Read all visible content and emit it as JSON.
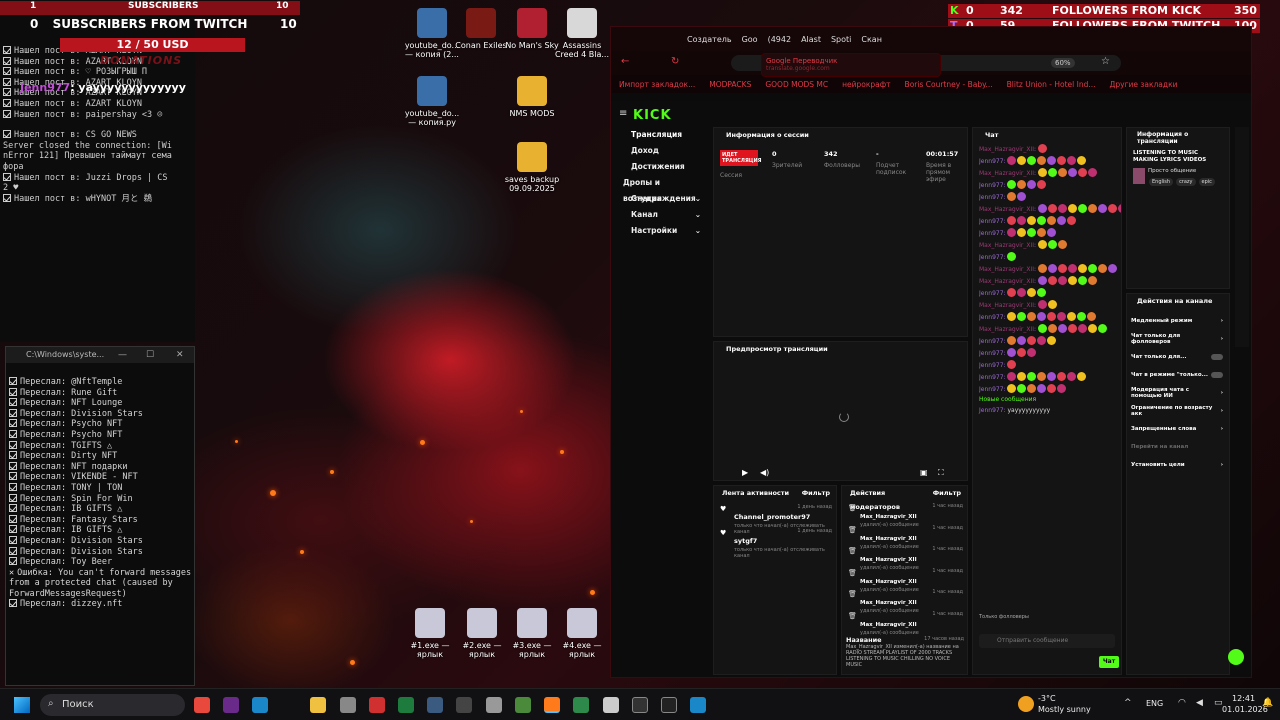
{
  "overlay": {
    "row1_left": "1",
    "row1_label": "SUBSCRIBERS",
    "row1_right": "10",
    "row2_left": "0",
    "subs_label": "SUBSCRIBERS FROM TWITCH",
    "row2_right": "10",
    "money": "12 / 50 USD",
    "donations": "DONATIONS",
    "chat_user": "Jenn977",
    "chat_msg": "yayyyyyyyyyyyyy"
  },
  "console1": {
    "lines": [
      "Нашел пост в: AZART KLOYN",
      "Нашел пост в: AZART KLOYN",
      "Нашел пост в: ♡ РОЗЫГРЫШ П",
      "Нашел пост в: AZART KLOYN",
      "Нашел пост в: AZART KLOYN",
      "Нашел пост в: AZART KLOYN",
      "Нашел пост в: paipershay <3 ☺",
      "",
      "Нашел пост в: CS GO NEWS",
      "Server closed the connection: [Wi",
      "nError 121] Превышен таймаут сема",
      "фора",
      "Нашел пост в: Juzzi Drops | CS",
      "2 ♥",
      "Нашел пост в: wHYNOT 月と 鵜"
    ]
  },
  "console2": {
    "title": "C:\\Windows\\syste...",
    "lines": [
      "Переслал: @NftTemple",
      "Переслал: Rune Gift",
      "Переслал: NFT Lounge",
      "Переслал: Division Stars",
      "Переслал: Psycho NFT",
      "Переслал: Psycho NFT",
      "Переслал: TGIFTS △",
      "Переслал: Dirty NFT",
      "Переслал: NFT подарки",
      "Переслал: VIKENDE - NFT",
      "Переслал: TONY | TON",
      "Переслал: Spin For Win",
      "Переслал: IB GIFTS △",
      "Переслал: Fantasy Stars",
      "Переслал: IB GIFTS △",
      "Переслал: Division Stars",
      "Переслал: Division Stars",
      "Переслал: Toy Beer"
    ],
    "error": "Ошибка: You can't forward messages from a protected chat (caused by ForwardMessagesRequest)",
    "last": "Переслал: dizzey.nft"
  },
  "desktop": [
    {
      "label": "youtube_do... — копия (2...",
      "color": "#3a6ea8"
    },
    {
      "label": "Conan Exiles",
      "color": "#7a1a14"
    },
    {
      "label": "No Man's Sky",
      "color": "#b02030"
    },
    {
      "label": "Assassins Creed 4 Bla...",
      "color": "#d8d8d8"
    },
    {
      "label": "youtube_do... — копия.py",
      "color": "#3a6ea8"
    },
    {
      "label": "NMS MODS",
      "color": "#e8b230"
    },
    {
      "label": "saves backup 09.09.2025",
      "color": "#e8b230"
    },
    {
      "label": "#1.exe — ярлык",
      "color": "#c8c8d8"
    },
    {
      "label": "#2.exe — ярлык",
      "color": "#c8c8d8"
    },
    {
      "label": "#3.exe — ярлык",
      "color": "#c8c8d8"
    },
    {
      "label": "#4.exe — ярлык",
      "color": "#c8c8d8"
    }
  ],
  "right_overlay": {
    "k_count": "0",
    "k_val": "342",
    "k_label": "FOLLOWERS FROM KICK",
    "k_goal": "350",
    "t_count": "0",
    "t_val": "59",
    "t_label": "FOLLOWERS FROM TWITCH",
    "t_goal": "100"
  },
  "browser": {
    "tabs": [
      "Создатель",
      "Goo",
      "(4942",
      "Alast",
      "Spoti",
      "Скан"
    ],
    "tooltip_title": "Google Переводчик",
    "tooltip_url": "translate.google.com",
    "zoom": "60%",
    "bookmarks": [
      "Импорт закладок...",
      "MODPACKS",
      "GOOD MODS MC",
      "нейрокрафт",
      "Boris Courtney - Baby...",
      "Blitz Union - Hotel Ind...",
      "Другие закладки"
    ]
  },
  "kick": {
    "logo": "KICK",
    "sidebar": [
      "Трансляция",
      "Доход",
      "Достижения",
      "Дропы и вознаграждения",
      "Студия",
      "Канал",
      "Настройки"
    ],
    "session": {
      "title": "Информация о сессии",
      "badge": "ИДЕТ ТРАНСЛЯЦИЯ",
      "badge_sub": "Сессия",
      "viewers": "0",
      "viewers_l": "Зрителей",
      "followers": "342",
      "followers_l": "Фолловеры",
      "subs": "-",
      "subs_l": "Подчет подписок",
      "time": "00:01:57",
      "time_l": "Время в прямом эфире"
    },
    "preview": "Предпросмотр трансляции",
    "chat": {
      "title": "Чат",
      "new_msgs": "Новые сообщения",
      "last_user": "Jenn977:",
      "last_msg": "yayyyyyyyyyy",
      "placeholder": "Отправить сообщение",
      "send": "Чат",
      "followers_only": "Только фолловеры",
      "users": [
        "Max_Hazragvir_XII",
        "Jenn977",
        "Max_Hazragvir_XII",
        "Jenn977",
        "Jenn977",
        "Max_Hazragvir_XII",
        "Jenn977",
        "Jenn977",
        "Max_Hazragvir_XII",
        "Jenn977",
        "Max_Hazragvir_XII",
        "Max_Hazragvir_XII",
        "Jenn977",
        "Max_Hazragvir_XII",
        "Jenn977",
        "Max_Hazragvir_XII",
        "Jenn977",
        "Jenn977",
        "Jenn977",
        "Jenn977",
        "Jenn977"
      ]
    },
    "info": {
      "title": "Информация о трансляции",
      "stream_title": "LISTENING TO MUSIC MAKING LYRICS VIDEOS",
      "category": "Просто общение",
      "tags": [
        "English",
        "crazy",
        "epic"
      ]
    },
    "channel_actions": {
      "title": "Действия на канале",
      "items": [
        "Медленный режим",
        "Чат только для фолловеров",
        "Чат только для...",
        "Чат в режиме \"только...",
        "Модерация чата с помощью ИИ",
        "Ограничение по возрасту акк",
        "Запрещенные слова",
        "Перейти на канал",
        "Установить цели"
      ]
    },
    "activity": {
      "title": "Лента активности",
      "filter": "Фильтр",
      "items": [
        {
          "user": "Channel_promoter97",
          "time": "1 день назад",
          "desc": "только что начал(-а) отслеживать канал"
        },
        {
          "user": "sytgf7",
          "time": "1 день назад",
          "desc": "только что начал(-а) отслеживать канал"
        }
      ]
    },
    "mod_actions": {
      "title": "Действия модераторов",
      "filter": "Фильтр",
      "items": [
        {
          "user": "Max_Hazragvir_XII",
          "time": "1 час назад",
          "desc": "удалил(-а) сообщение"
        },
        {
          "user": "Max_Hazragvir_XII",
          "time": "1 час назад",
          "desc": "удалил(-а) сообщение"
        },
        {
          "user": "Max_Hazragvir_XII",
          "time": "1 час назад",
          "desc": "удалил(-а) сообщение"
        },
        {
          "user": "Max_Hazragvir_XII",
          "time": "1 час назад",
          "desc": "удалил(-а) сообщение"
        },
        {
          "user": "Max_Hazragvir_XII",
          "time": "1 час назад",
          "desc": "удалил(-а) сообщение"
        },
        {
          "user": "Max_Hazragvir_XII",
          "time": "1 час назад",
          "desc": "удалил(-а) сообщение"
        }
      ],
      "title_change": {
        "label": "Название",
        "time": "17 часов назад",
        "desc": "Max_Hazragvir_XII изменил(-а) название на RADIO STREAM PLAYLIST OF 2000 TRACKS LISTENING TO MUSIC CHILLING NO VOICE MUSIC"
      }
    }
  },
  "taskbar": {
    "search": "Поиск",
    "weather_temp": "-3°C",
    "weather_text": "Mostly sunny",
    "lang": "ENG",
    "time": "12:41",
    "date": "01.01.2026"
  }
}
